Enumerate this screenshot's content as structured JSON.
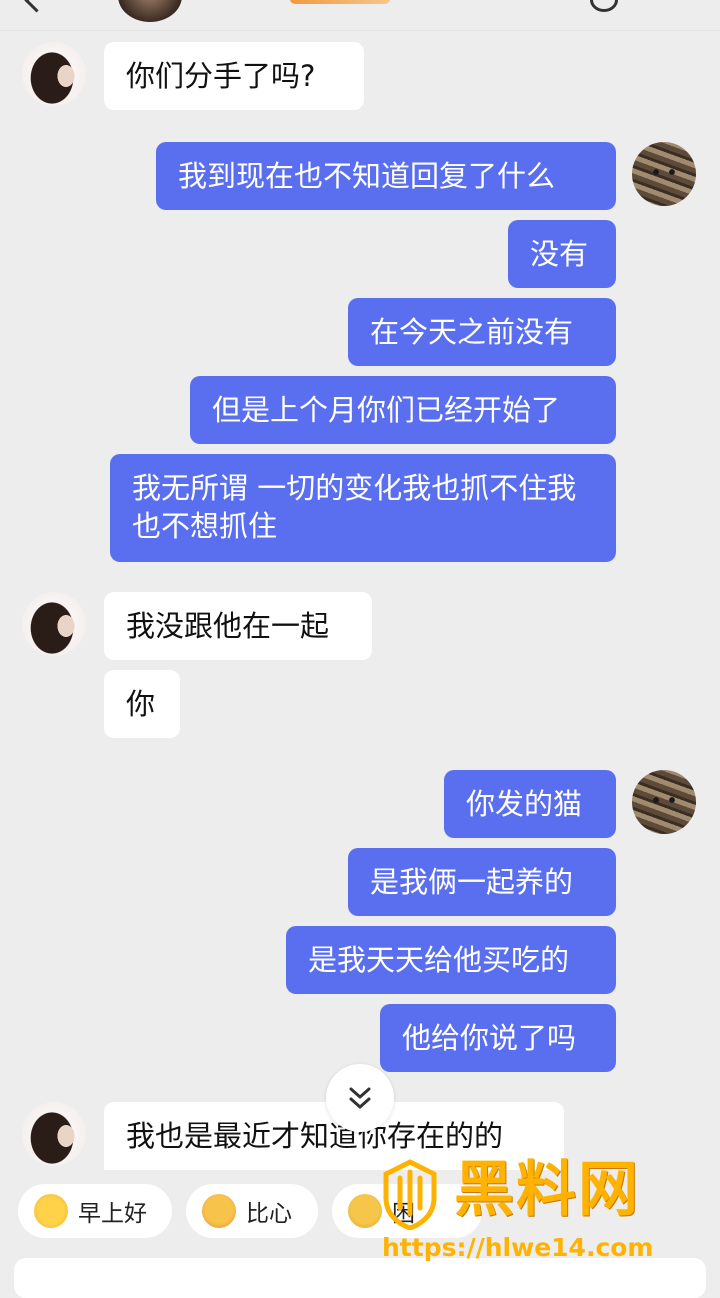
{
  "messages": [
    {
      "side": "in",
      "text": "你们分手了吗?"
    },
    {
      "side": "out",
      "text": "我到现在也不知道回复了什么"
    },
    {
      "side": "out",
      "text": "没有"
    },
    {
      "side": "out",
      "text": "在今天之前没有"
    },
    {
      "side": "out",
      "text": "但是上个月你们已经开始了"
    },
    {
      "side": "out",
      "text": "我无所谓 一切的变化我也抓不住我也不想抓住"
    },
    {
      "side": "in",
      "text": "我没跟他在一起"
    },
    {
      "side": "in",
      "text": "你"
    },
    {
      "side": "out",
      "text": "你发的猫"
    },
    {
      "side": "out",
      "text": "是我俩一起养的"
    },
    {
      "side": "out",
      "text": "是我天天给他买吃的"
    },
    {
      "side": "out",
      "text": "他给你说了吗"
    },
    {
      "side": "in",
      "text": "我也是最近才知道你存在的的"
    }
  ],
  "quick_replies": [
    {
      "label": "早上好",
      "icon": "sun-emoji-icon"
    },
    {
      "label": "比心",
      "icon": "heart-hands-emoji-icon"
    },
    {
      "label": "困",
      "icon": "sleepy-emoji-icon"
    }
  ],
  "scroll_icon": "double-chevron-down-icon",
  "watermark": {
    "title": "黑料网",
    "url": "https://hlwe14.com"
  },
  "colors": {
    "background": "#ededed",
    "outgoing_bubble": "#5a6ff0",
    "incoming_bubble": "#ffffff",
    "watermark": "#ffb300"
  }
}
